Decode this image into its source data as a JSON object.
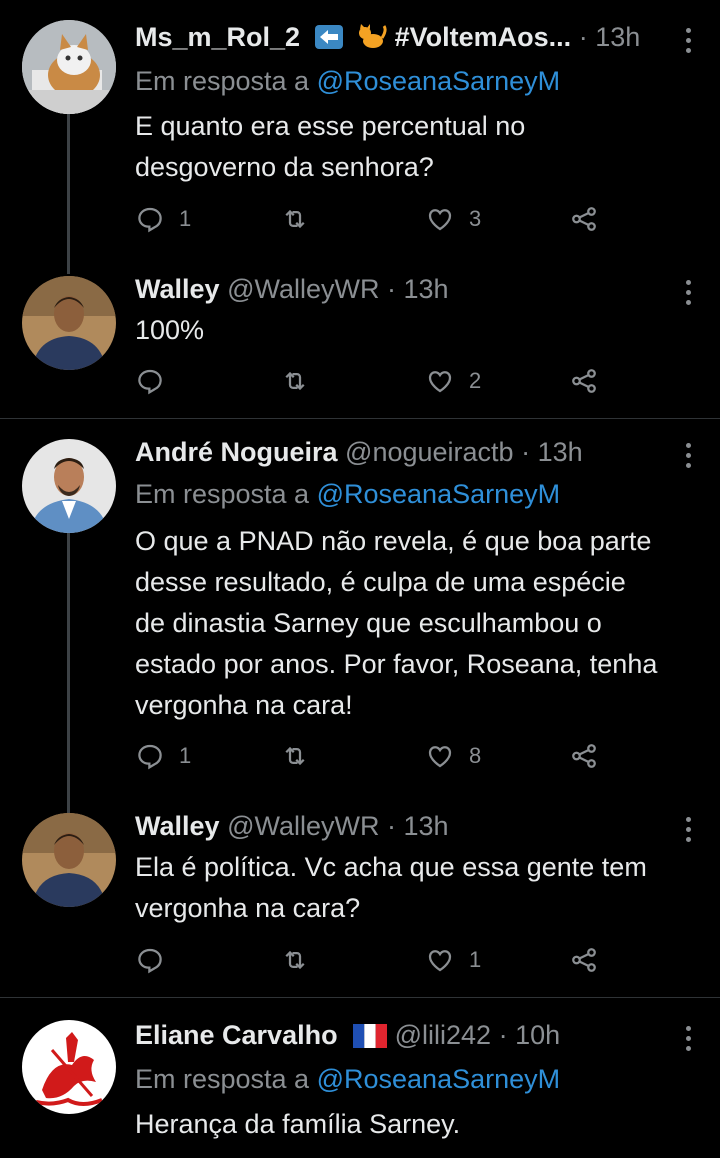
{
  "tweets": [
    {
      "name": "Ms_m_Rol_2",
      "display_extra": "#VoltemAos...",
      "handle": "",
      "time": "13h",
      "reply_prefix": "Em resposta a",
      "reply_to": "@RoseanaSarneyM",
      "text_lines": [
        "E quanto era esse percentual no",
        "desgoverno da senhora?"
      ],
      "replies": "1",
      "retweets": "",
      "likes": "3",
      "avatar": "cat-avatar",
      "badges": [
        "left-arrow-emoji-icon",
        "cat-emoji-icon"
      ]
    },
    {
      "name": "Walley",
      "handle": "@WalleyWR",
      "time": "13h",
      "text_lines": [
        "100%"
      ],
      "replies": "",
      "retweets": "",
      "likes": "2",
      "avatar": "man-avatar"
    },
    {
      "name": "André Nogueira",
      "handle": "@nogueiractb",
      "time": "13h",
      "reply_prefix": "Em resposta a",
      "reply_to": "@RoseanaSarneyM",
      "text_lines": [
        "O que a PNAD não revela, é que boa parte",
        "desse resultado, é culpa de uma espécie",
        "de dinastia Sarney que esculhambou o",
        "estado por anos. Por favor, Roseana, tenha",
        "vergonha na cara!"
      ],
      "replies": "1",
      "retweets": "",
      "likes": "8",
      "avatar": "man-avatar"
    },
    {
      "name": "Walley",
      "handle": "@WalleyWR",
      "time": "13h",
      "text_lines": [
        "Ela é política. Vc acha que essa gente tem",
        "vergonha na cara?"
      ],
      "replies": "",
      "retweets": "",
      "likes": "1",
      "avatar": "man-avatar"
    },
    {
      "name": "Eliane Carvalho",
      "handle": "@lili242",
      "time": "10h",
      "reply_prefix": "Em resposta a",
      "reply_to": "@RoseanaSarneyM",
      "text_lines": [
        "Herança da família Sarney."
      ],
      "avatar": "saint-george-avatar",
      "badges": [
        "france-flag-icon"
      ]
    }
  ],
  "separator": "·",
  "colors": {
    "background": "#000000",
    "mention": "#2f8fd8",
    "muted": "#8b8f93",
    "text": "#e7e9ea"
  }
}
